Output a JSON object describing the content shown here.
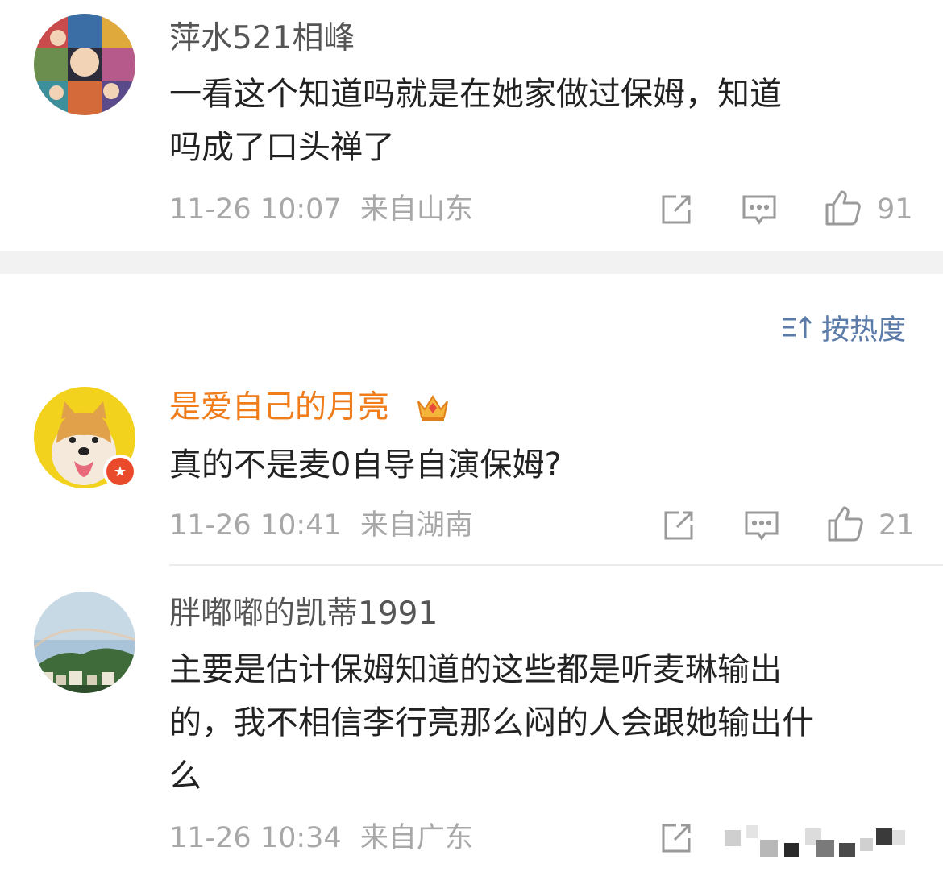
{
  "sort": {
    "label": "按热度",
    "icon": "sort-icon"
  },
  "comments": [
    {
      "username": "萍水521相峰",
      "text_lines": [
        "一看这个知道吗就是在她家做过保姆，知道",
        "吗成了口头禅了"
      ],
      "time": "11-26 10:07",
      "location": "来自山东",
      "likes": "91",
      "avatar": "anime-collage-avatar"
    },
    {
      "username": "是爱自己的月亮",
      "vip_icon": "crown-icon",
      "text_lines": [
        "真的不是麦0自导自演保姆?"
      ],
      "time": "11-26 10:41",
      "location": "来自湖南",
      "likes": "21",
      "avatar": "shiba-dog-avatar"
    },
    {
      "username": "胖嘟嘟的凯蒂1991",
      "text_lines": [
        "主要是估计保姆知道的这些都是听麦琳输出",
        "的，我不相信李行亮那么闷的人会跟她输出什",
        "么"
      ],
      "time": "11-26 10:34",
      "location": "来自广东",
      "avatar": "rainbow-landscape-avatar"
    }
  ],
  "colors": {
    "vip_name": "#f07c1a",
    "sort_link": "#5b7ba8",
    "meta_gray": "#a8a8a8",
    "section_gap": "#f2f2f2"
  }
}
